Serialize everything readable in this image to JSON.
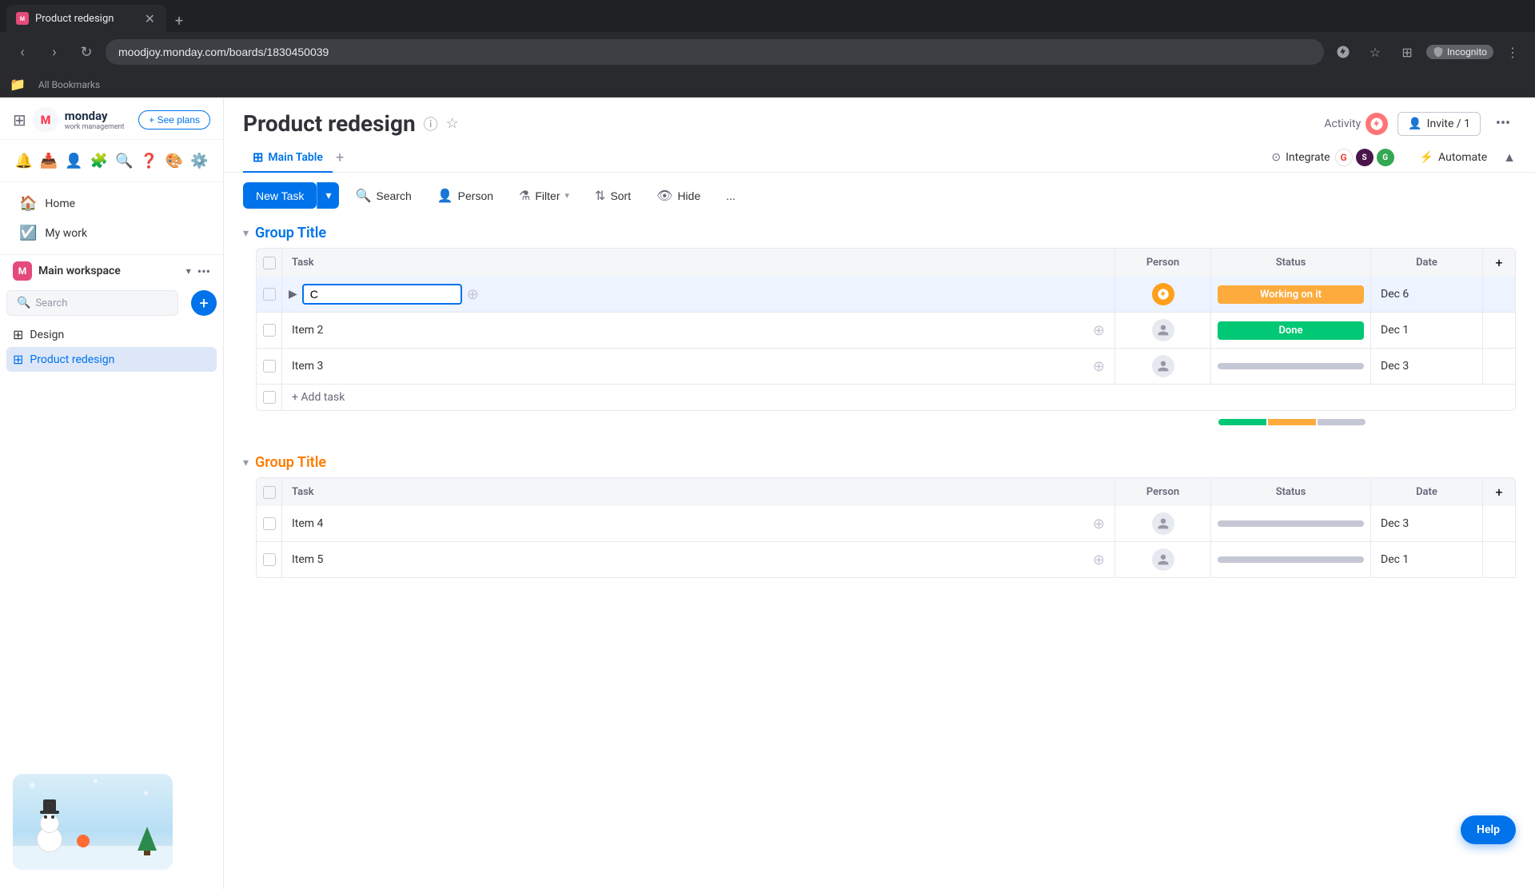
{
  "browser": {
    "tab_title": "Product redesign",
    "tab_favicon": "M",
    "url": "moodjoy.monday.com/boards/1830450039",
    "incognito_label": "Incognito",
    "bookmarks_label": "All Bookmarks"
  },
  "app_header": {
    "logo_brand": "monday",
    "logo_sub": "work management",
    "see_plans_label": "+ See plans",
    "icons": [
      "bell",
      "inbox",
      "person-add",
      "apps",
      "search",
      "question",
      "color-swatch",
      "gear"
    ]
  },
  "sidebar": {
    "home_label": "Home",
    "my_work_label": "My work",
    "workspace_name": "Main workspace",
    "workspace_avatar": "M",
    "search_placeholder": "Search",
    "items": [
      {
        "label": "Design",
        "active": false
      },
      {
        "label": "Product redesign",
        "active": true
      }
    ]
  },
  "page": {
    "title": "Product redesign",
    "activity_label": "Activity",
    "invite_label": "Invite / 1",
    "tabs": [
      {
        "label": "Main Table",
        "active": true
      }
    ],
    "tab_add_label": "+",
    "toolbar": {
      "new_task_label": "New Task",
      "search_label": "Search",
      "person_label": "Person",
      "filter_label": "Filter",
      "sort_label": "Sort",
      "hide_label": "Hide",
      "more_label": "..."
    },
    "right_toolbar": {
      "integrate_label": "Integrate",
      "automate_label": "Automate"
    }
  },
  "group1": {
    "title": "Group Title",
    "color": "#0073ea",
    "columns": {
      "task": "Task",
      "person": "Person",
      "status": "Status",
      "date": "Date"
    },
    "rows": [
      {
        "id": 1,
        "task": "C",
        "task_editing": true,
        "person_colored": true,
        "status": "Working on it",
        "status_class": "working",
        "date": "Dec 6"
      },
      {
        "id": 2,
        "task": "Item 2",
        "task_editing": false,
        "person_colored": false,
        "status": "Done",
        "status_class": "done",
        "date": "Dec 1"
      },
      {
        "id": 3,
        "task": "Item 3",
        "task_editing": false,
        "person_colored": false,
        "status": "",
        "status_class": "none",
        "date": "Dec 3"
      }
    ],
    "add_task_label": "+ Add task",
    "status_summary": {
      "done_segments": 1,
      "working_segments": 1,
      "none_segments": 1
    }
  },
  "group2": {
    "title": "Group Title",
    "color": "#ff7b00",
    "columns": {
      "task": "Task",
      "person": "Person",
      "status": "Status",
      "date": "Date"
    },
    "rows": [
      {
        "id": 4,
        "task": "Item 4",
        "task_editing": false,
        "person_colored": false,
        "status": "",
        "status_class": "none",
        "date": "Dec 3"
      },
      {
        "id": 5,
        "task": "Item 5",
        "task_editing": false,
        "person_colored": false,
        "status": "",
        "status_class": "none",
        "date": "Dec 1"
      }
    ]
  },
  "help_label": "Help"
}
